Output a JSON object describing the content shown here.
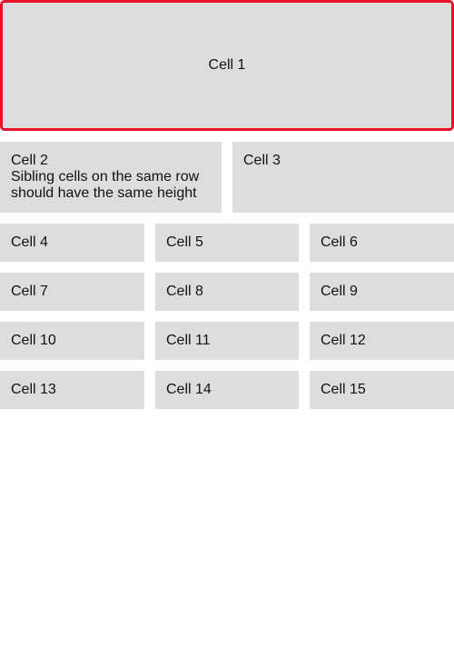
{
  "colors": {
    "cell_background": "#dddddd",
    "selected_border": "#e8132a",
    "page_background": "#ffffff"
  },
  "cells": {
    "cell_1": {
      "label": "Cell 1",
      "selected": true
    },
    "cell_2": {
      "label": "Cell 2",
      "description_line_1": "Sibling cells on the same row",
      "description_line_2": "should have the same height"
    },
    "cell_3": {
      "label": "Cell 3"
    },
    "cell_4": {
      "label": "Cell 4"
    },
    "cell_5": {
      "label": "Cell 5"
    },
    "cell_6": {
      "label": "Cell 6"
    },
    "cell_7": {
      "label": "Cell 7"
    },
    "cell_8": {
      "label": "Cell 8"
    },
    "cell_9": {
      "label": "Cell 9"
    },
    "cell_10": {
      "label": "Cell 10"
    },
    "cell_11": {
      "label": "Cell 11"
    },
    "cell_12": {
      "label": "Cell 12"
    },
    "cell_13": {
      "label": "Cell 13"
    },
    "cell_14": {
      "label": "Cell 14"
    },
    "cell_15": {
      "label": "Cell 15"
    }
  }
}
